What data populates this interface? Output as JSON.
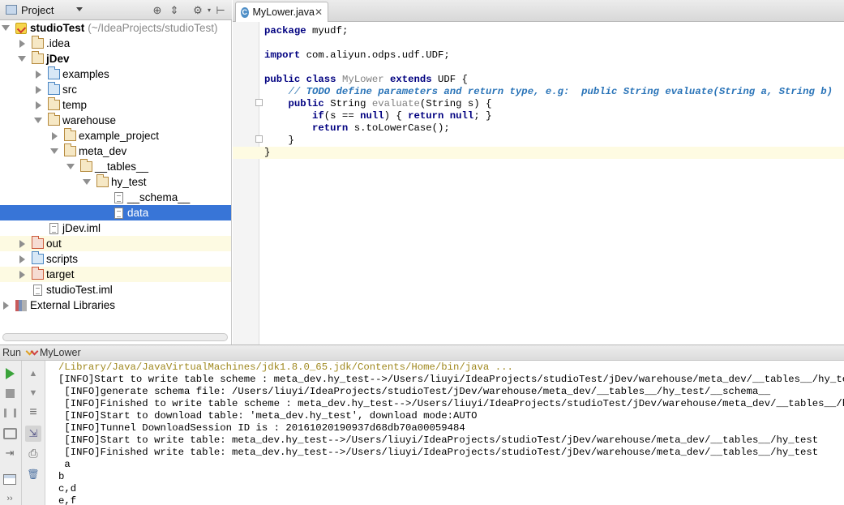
{
  "project_panel": {
    "selector_label": "Project",
    "tree": [
      {
        "label": "studioTest",
        "path": "(~/IdeaProjects/studioTest)",
        "indent": 0,
        "arrow": "d",
        "icon": "module",
        "bold": true
      },
      {
        "label": ".idea",
        "indent": 1,
        "arrow": "r",
        "icon": "folder"
      },
      {
        "label": "jDev",
        "indent": 1,
        "arrow": "d",
        "icon": "folder",
        "bold": true
      },
      {
        "label": "examples",
        "indent": 2,
        "arrow": "r",
        "icon": "folder-blue"
      },
      {
        "label": "src",
        "indent": 2,
        "arrow": "r",
        "icon": "folder-blue"
      },
      {
        "label": "temp",
        "indent": 2,
        "arrow": "r",
        "icon": "folder"
      },
      {
        "label": "warehouse",
        "indent": 2,
        "arrow": "d",
        "icon": "folder"
      },
      {
        "label": "example_project",
        "indent": 3,
        "arrow": "r",
        "icon": "folder"
      },
      {
        "label": "meta_dev",
        "indent": 3,
        "arrow": "d",
        "icon": "folder"
      },
      {
        "label": "__tables__",
        "indent": 4,
        "arrow": "d",
        "icon": "folder"
      },
      {
        "label": "hy_test",
        "indent": 5,
        "arrow": "d",
        "icon": "folder"
      },
      {
        "label": "__schema__",
        "indent": 6,
        "arrow": "none",
        "icon": "file"
      },
      {
        "label": "data",
        "indent": 6,
        "arrow": "none",
        "icon": "file",
        "selected": true
      },
      {
        "label": "jDev.iml",
        "indent": 2,
        "arrow": "none",
        "icon": "file"
      },
      {
        "label": "out",
        "indent": 1,
        "arrow": "r",
        "icon": "folder-red",
        "highlight": true
      },
      {
        "label": "scripts",
        "indent": 1,
        "arrow": "r",
        "icon": "folder-blue"
      },
      {
        "label": "target",
        "indent": 1,
        "arrow": "r",
        "icon": "folder-red",
        "highlight": true
      },
      {
        "label": "studioTest.iml",
        "indent": 1,
        "arrow": "none",
        "icon": "file"
      },
      {
        "label": "External Libraries",
        "indent": 0,
        "arrow": "r",
        "icon": "library"
      }
    ]
  },
  "editor": {
    "tab_label": "MyLower.java",
    "lines": [
      [
        [
          "kw",
          "package"
        ],
        [
          "",
          "myudf;"
        ]
      ],
      [],
      [
        [
          "kw",
          "import"
        ],
        [
          "",
          "com.aliyun.odps.udf.UDF;"
        ]
      ],
      [],
      [
        [
          "kw",
          "public class"
        ],
        [
          "gr",
          "MyLower"
        ],
        [
          "kw",
          "extends"
        ],
        [
          "",
          "UDF {"
        ]
      ],
      [
        [
          "cm",
          "    // "
        ],
        [
          "todo",
          "TODO define parameters and return type, e.g:  public String evaluate(String a, String b)"
        ]
      ],
      [
        [
          "kw",
          "    public"
        ],
        [
          "",
          "String"
        ],
        [
          "gr",
          "evaluate"
        ],
        [
          "",
          "(String s) {"
        ]
      ],
      [
        [
          "kw",
          "        if"
        ],
        [
          "",
          "(s =="
        ],
        [
          "kw",
          "null"
        ],
        [
          "",
          ") {"
        ],
        [
          "kw",
          "return null"
        ],
        [
          "",
          "; }"
        ]
      ],
      [
        [
          "kw",
          "        return"
        ],
        [
          "",
          "s.toLowerCase();"
        ]
      ],
      [
        [
          "",
          "    }"
        ]
      ],
      [
        [
          "",
          "}"
        ]
      ]
    ]
  },
  "run_panel": {
    "title": "Run",
    "config_name": "MyLower",
    "output": [
      {
        "text": "/Library/Java/JavaVirtualMachines/jdk1.8.0_65.jdk/Contents/Home/bin/java ...",
        "type": "cmd"
      },
      {
        "text": "[INFO]Start to write table scheme : meta_dev.hy_test-->/Users/liuyi/IdeaProjects/studioTest/jDev/warehouse/meta_dev/__tables__/hy_test"
      },
      {
        "text": " [INFO]generate schema file: /Users/liuyi/IdeaProjects/studioTest/jDev/warehouse/meta_dev/__tables__/hy_test/__schema__"
      },
      {
        "text": " [INFO]Finished to write table scheme : meta_dev.hy_test-->/Users/liuyi/IdeaProjects/studioTest/jDev/warehouse/meta_dev/__tables__/hy_test"
      },
      {
        "text": " [INFO]Start to download table: 'meta_dev.hy_test', download mode:AUTO"
      },
      {
        "text": " [INFO]Tunnel DownloadSession ID is : 20161020190937d68db70a00059484"
      },
      {
        "text": " [INFO]Start to write table: meta_dev.hy_test-->/Users/liuyi/IdeaProjects/studioTest/jDev/warehouse/meta_dev/__tables__/hy_test"
      },
      {
        "text": " [INFO]Finished write table: meta_dev.hy_test-->/Users/liuyi/IdeaProjects/studioTest/jDev/warehouse/meta_dev/__tables__/hy_test"
      },
      {
        "text": " a"
      },
      {
        "text": "b"
      },
      {
        "text": "c,d"
      },
      {
        "text": "e,f"
      }
    ]
  }
}
